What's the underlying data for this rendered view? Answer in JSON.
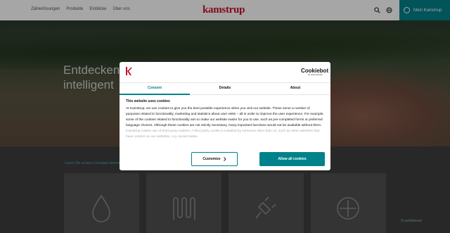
{
  "header": {
    "nav": [
      "Zählerlösungen",
      "Produkte",
      "Einblicke",
      "Über uns"
    ],
    "logo": "kamstrup",
    "login_label": "Mein Kamstrup",
    "icons": [
      "search-icon",
      "globe-icon",
      "person-icon"
    ]
  },
  "hero": {
    "title_line1": "Entdecken",
    "title_line2": "intelligent"
  },
  "lower": {
    "label": "Lesen Sie unsere Lösungen kennen",
    "cards": [
      "water-drop-icon",
      "heat-coil-icon",
      "plug-icon",
      "plus-circle-icon"
    ]
  },
  "watermark": "ScanMalware",
  "cookie_dialog": {
    "brand": "Cookiebot",
    "brand_by": "by Usercentrics",
    "tabs": [
      "Consent",
      "Details",
      "About"
    ],
    "active_tab": "Consent",
    "heading": "This website uses cookies",
    "paragraph1": "At Kamstrup, we use cookies to give you the best possible experience when you visit our website. These serve a number of purposes related to functionality, marketing and statistics about user visits – all in order to improve the user experience. For example, some of the cookies related to functionality aim to make our website easier for you to use, such as pre-completed forms or preferred language choices. Although these cookies are not strictly necessary, many important functions would not be available without them.",
    "paragraph2": "Kamstrup makes use of third party cookies. A third party cookie is installed by someone other than us, such as other websites that have content on our websites, e.g. social media.",
    "customize_label": "Customize",
    "accept_label": "Allow all cookies",
    "accent": "#00828a"
  }
}
